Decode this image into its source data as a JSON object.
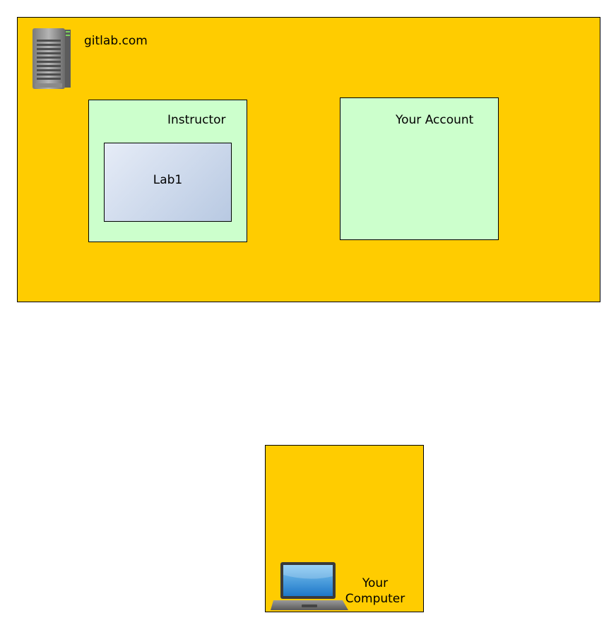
{
  "server": {
    "label": "gitlab.com",
    "icon": "server-icon"
  },
  "instructor": {
    "label": "Instructor",
    "repo_label": "Lab1"
  },
  "account": {
    "label": "Your Account"
  },
  "computer": {
    "label_line1": "Your",
    "label_line2": "Computer",
    "icon": "laptop-icon"
  },
  "colors": {
    "container": "#ffcc00",
    "account_box": "#ccffcc",
    "repo_box_start": "#e6ecf7",
    "repo_box_end": "#b8c9e2"
  }
}
